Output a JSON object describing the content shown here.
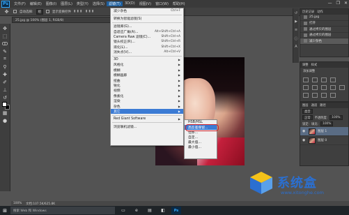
{
  "app": {
    "logo": "Ps",
    "menubar": [
      "文件(F)",
      "编辑(E)",
      "图像(I)",
      "图层(L)",
      "类型(Y)",
      "选择(S)",
      "滤镜(T)",
      "3D(D)",
      "视图(V)",
      "窗口(W)",
      "帮助(H)"
    ],
    "active_menu_index": 6,
    "window_controls": [
      "—",
      "❐",
      "✕"
    ]
  },
  "options_bar": {
    "auto_select_label": "自动选择:",
    "auto_select_value": "组",
    "show_transform_label": "显示变换控件"
  },
  "document_tab": "25.jpg @ 100% (图层 1, RGB/8)",
  "filter_menu": {
    "items": [
      {
        "label": "减少杂色",
        "shortcut": "Ctrl+F",
        "type": "item"
      },
      {
        "type": "sep"
      },
      {
        "label": "转换为智能滤镜(S)",
        "shortcut": "",
        "type": "item"
      },
      {
        "type": "sep"
      },
      {
        "label": "滤镜库(G)...",
        "shortcut": "",
        "type": "item"
      },
      {
        "label": "自适应广角(A)...",
        "shortcut": "Alt+Shift+Ctrl+A",
        "type": "item"
      },
      {
        "label": "Camera Raw 滤镜(C)...",
        "shortcut": "Shift+Ctrl+A",
        "type": "item"
      },
      {
        "label": "镜头校正(R)...",
        "shortcut": "Shift+Ctrl+R",
        "type": "item"
      },
      {
        "label": "液化(L)...",
        "shortcut": "Shift+Ctrl+X",
        "type": "item"
      },
      {
        "label": "消失点(V)...",
        "shortcut": "Alt+Ctrl+V",
        "type": "item"
      },
      {
        "type": "sep"
      },
      {
        "label": "3D",
        "shortcut": "",
        "type": "sub"
      },
      {
        "label": "风格化",
        "shortcut": "",
        "type": "sub"
      },
      {
        "label": "模糊",
        "shortcut": "",
        "type": "sub"
      },
      {
        "label": "模糊画廊",
        "shortcut": "",
        "type": "sub"
      },
      {
        "label": "扭曲",
        "shortcut": "",
        "type": "sub"
      },
      {
        "label": "锐化",
        "shortcut": "",
        "type": "sub"
      },
      {
        "label": "视频",
        "shortcut": "",
        "type": "sub"
      },
      {
        "label": "像素化",
        "shortcut": "",
        "type": "sub"
      },
      {
        "label": "渲染",
        "shortcut": "",
        "type": "sub"
      },
      {
        "label": "杂色",
        "shortcut": "",
        "type": "sub"
      },
      {
        "label": "其它",
        "shortcut": "",
        "type": "sub",
        "highlight": true
      },
      {
        "type": "sep"
      },
      {
        "label": "Red Giant Software",
        "shortcut": "",
        "type": "sub"
      },
      {
        "type": "sep"
      },
      {
        "label": "浏览联机滤镜...",
        "shortcut": "",
        "type": "item"
      }
    ]
  },
  "submenu": {
    "items": [
      "HSB/HSL",
      "高反差保留...",
      "位移...",
      "自定...",
      "最大值...",
      "最小值..."
    ],
    "highlight_index": 1
  },
  "history_panel": {
    "tabs": [
      "历史记录",
      "动作"
    ],
    "items": [
      "25.jpg",
      "打开",
      "通过拷贝的图层",
      "通过拷贝的图层",
      "减少杂色"
    ],
    "selected_index": 4
  },
  "adjust_panel": {
    "tabs": [
      "调整",
      "样式"
    ],
    "title": "添加调整"
  },
  "layers_panel": {
    "tabs": [
      "图层",
      "通道",
      "路径"
    ],
    "kind_label": "类型",
    "blend_mode": "正常",
    "opacity_label": "不透明度:",
    "opacity_value": "100%",
    "lock_label": "锁定:",
    "fill_label": "填充:",
    "fill_value": "100%",
    "layers": [
      {
        "name": "图层 1",
        "selected": true
      },
      {
        "name": "图层 0",
        "selected": false
      }
    ]
  },
  "status_bar": {
    "zoom": "100%",
    "doc_info": "文档:107.5K/625.8K"
  },
  "taskbar": {
    "start": "⊞",
    "search_placeholder": "搜索 Web 和 Windows",
    "icons": [
      "▭",
      "e",
      "▤",
      "◧",
      "Ps"
    ]
  },
  "watermark": {
    "text": "系统盒",
    "url": "www.xitonghe.com"
  },
  "colors": {
    "menu_highlight": "#3b7bd4",
    "annotation_box": "#d0202a",
    "watermark": "#2b6fd0"
  }
}
